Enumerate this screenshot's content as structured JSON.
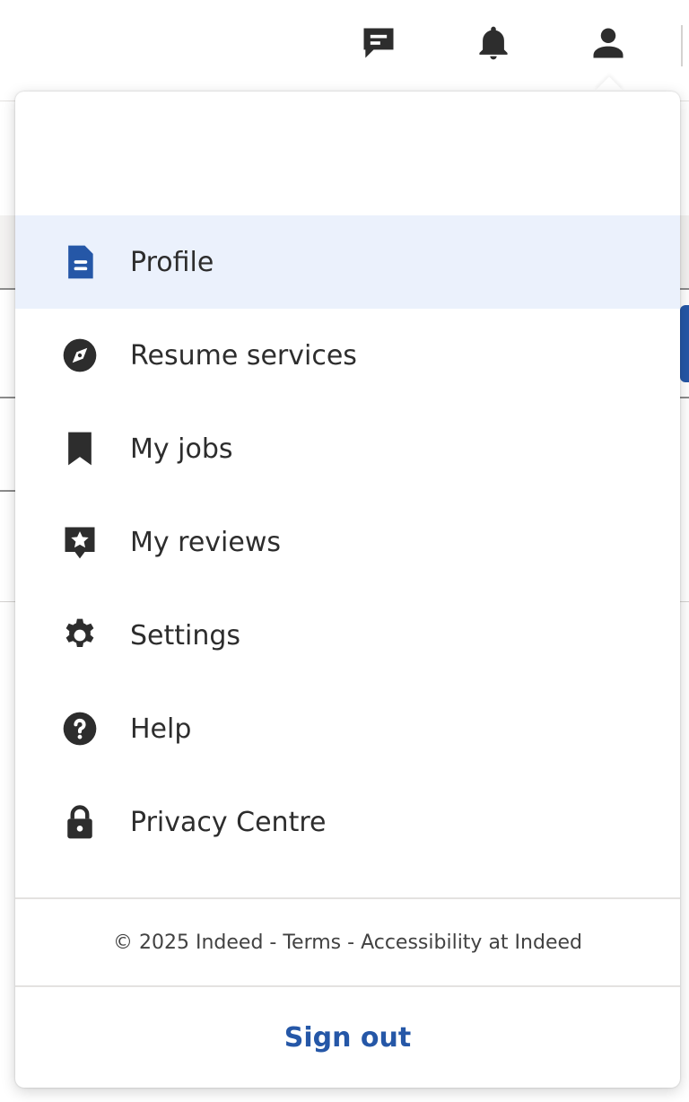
{
  "header": {
    "icons": [
      "messages-icon",
      "notifications-bell-icon",
      "account-person-icon"
    ]
  },
  "menu": {
    "items": [
      {
        "label": "Profile",
        "icon": "document-icon",
        "active": true
      },
      {
        "label": "Resume services",
        "icon": "compass-icon",
        "active": false
      },
      {
        "label": "My jobs",
        "icon": "bookmark-icon",
        "active": false
      },
      {
        "label": "My reviews",
        "icon": "review-star-icon",
        "active": false
      },
      {
        "label": "Settings",
        "icon": "gear-icon",
        "active": false
      },
      {
        "label": "Help",
        "icon": "question-circle-icon",
        "active": false
      },
      {
        "label": "Privacy Centre",
        "icon": "lock-icon",
        "active": false
      }
    ],
    "footer": {
      "copyright": "© 2025 Indeed",
      "sep1": " - ",
      "terms": "Terms",
      "sep2": " - ",
      "accessibility": "Accessibility at Indeed"
    },
    "sign_out": "Sign out"
  },
  "colors": {
    "accent_blue": "#2557a7",
    "active_bg": "#ebf1fc",
    "text": "#2d2d2d"
  }
}
